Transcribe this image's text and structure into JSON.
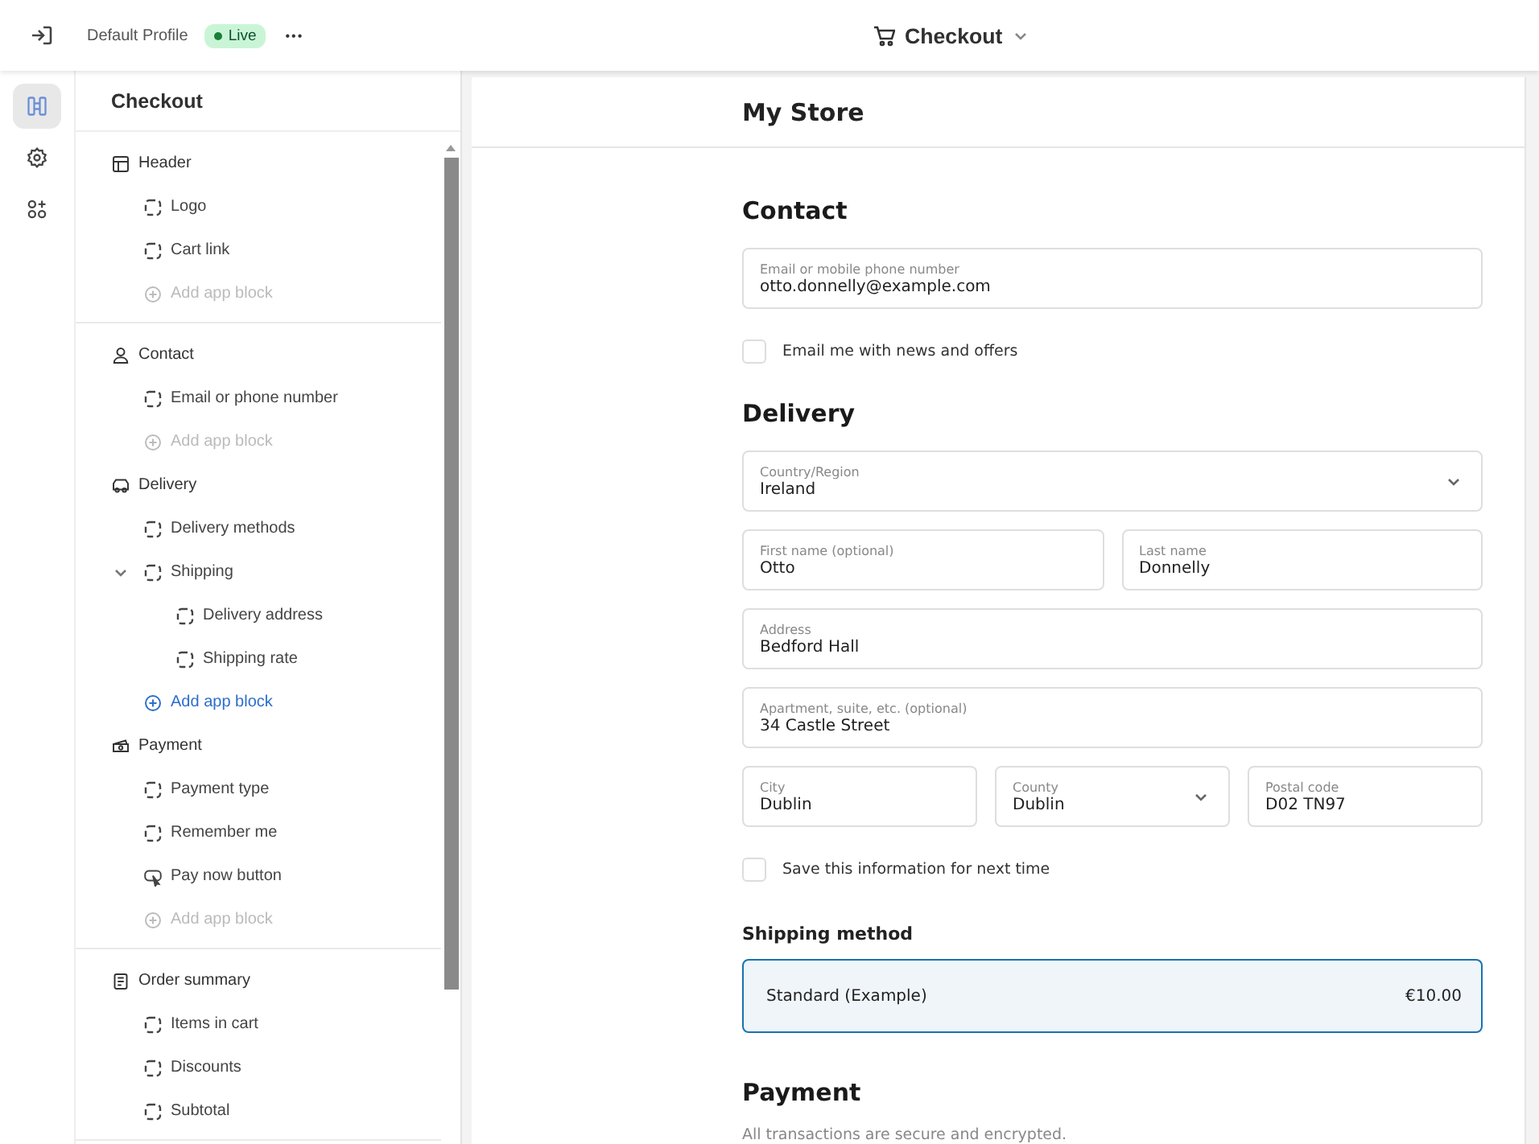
{
  "topbar": {
    "profile": "Default Profile",
    "status": {
      "label": "Live",
      "color": "#1a7f37"
    },
    "more": "•••",
    "page": "Checkout"
  },
  "rail": [
    {
      "kind": "blocks",
      "selected": true
    },
    {
      "kind": "settings",
      "selected": false
    },
    {
      "kind": "apps",
      "selected": false
    }
  ],
  "sidebar": {
    "title": "Checkout",
    "groups": [
      [
        {
          "label": "Header",
          "kind": "header",
          "items": [
            {
              "label": "Logo",
              "kind": "block"
            },
            {
              "label": "Cart link",
              "kind": "block"
            },
            {
              "label": "Add app block",
              "kind": "add",
              "disabled": true
            }
          ]
        }
      ],
      [
        {
          "label": "Contact",
          "kind": "contact",
          "items": [
            {
              "label": "Email or phone number",
              "kind": "block"
            },
            {
              "label": "Add app block",
              "kind": "add",
              "disabled": true
            }
          ]
        },
        {
          "label": "Delivery",
          "kind": "delivery",
          "items": [
            {
              "label": "Delivery methods",
              "kind": "block"
            },
            {
              "label": "Shipping",
              "kind": "block",
              "expanded": true,
              "children": [
                {
                  "label": "Delivery address",
                  "kind": "block"
                },
                {
                  "label": "Shipping rate",
                  "kind": "block"
                }
              ]
            },
            {
              "label": "Add app block",
              "kind": "add",
              "disabled": false
            }
          ]
        },
        {
          "label": "Payment",
          "kind": "payment",
          "items": [
            {
              "label": "Payment type",
              "kind": "block"
            },
            {
              "label": "Remember me",
              "kind": "block"
            },
            {
              "label": "Pay now button",
              "kind": "button"
            },
            {
              "label": "Add app block",
              "kind": "add",
              "disabled": true
            }
          ]
        }
      ],
      [
        {
          "label": "Order summary",
          "kind": "summary",
          "items": [
            {
              "label": "Items in cart",
              "kind": "block"
            },
            {
              "label": "Discounts",
              "kind": "block"
            },
            {
              "label": "Subtotal",
              "kind": "block"
            }
          ]
        }
      ]
    ]
  },
  "preview": {
    "store": "My Store",
    "sections": [
      {
        "kind": "heading",
        "text": "Contact"
      },
      {
        "kind": "fields",
        "fields": [
          {
            "label": "Email or mobile phone number",
            "value": "otto.donnelly@example.com",
            "kind": "text"
          }
        ]
      },
      {
        "kind": "checkbox",
        "label": "Email me with news and offers",
        "checked": false
      },
      {
        "kind": "heading",
        "text": "Delivery"
      },
      {
        "kind": "fields",
        "fields": [
          {
            "label": "Country/Region",
            "value": "Ireland",
            "kind": "select"
          }
        ]
      },
      {
        "kind": "fields",
        "fields": [
          {
            "label": "First name (optional)",
            "value": "Otto",
            "kind": "text"
          },
          {
            "label": "Last name",
            "value": "Donnelly",
            "kind": "text"
          }
        ]
      },
      {
        "kind": "fields",
        "fields": [
          {
            "label": "Address",
            "value": "Bedford Hall",
            "kind": "text"
          }
        ]
      },
      {
        "kind": "fields",
        "fields": [
          {
            "label": "Apartment, suite, etc. (optional)",
            "value": "34 Castle Street",
            "kind": "text"
          }
        ]
      },
      {
        "kind": "fields",
        "fields": [
          {
            "label": "City",
            "value": "Dublin",
            "kind": "text"
          },
          {
            "label": "County",
            "value": "Dublin",
            "kind": "select"
          },
          {
            "label": "Postal code",
            "value": "D02 TN97",
            "kind": "text"
          }
        ]
      },
      {
        "kind": "checkbox",
        "label": "Save this information for next time",
        "checked": false
      },
      {
        "kind": "subheading",
        "text": "Shipping method"
      },
      {
        "kind": "option",
        "label": "Standard (Example)",
        "price": "€10.00",
        "selected": true
      },
      {
        "kind": "heading",
        "text": "Payment"
      },
      {
        "kind": "note",
        "text": "All transactions are secure and encrypted."
      }
    ]
  }
}
